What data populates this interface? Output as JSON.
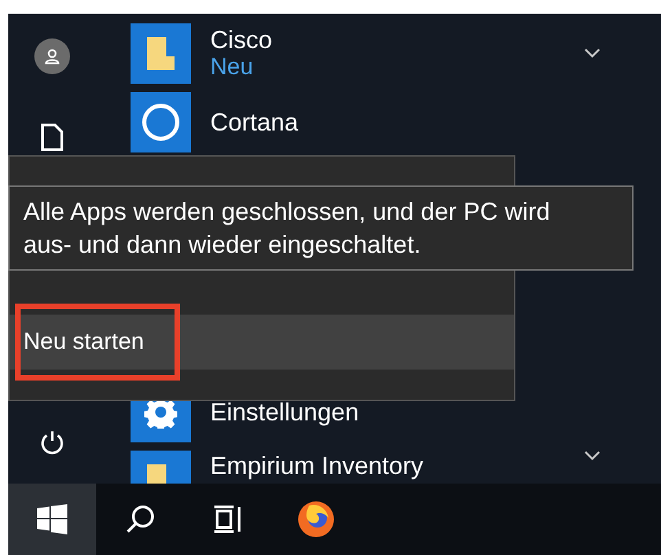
{
  "apps": [
    {
      "name": "Cisco",
      "badge": "Neu",
      "kind": "folder",
      "expandable": true
    },
    {
      "name": "Cortana",
      "kind": "cortana",
      "expandable": false
    },
    {
      "name": "Einstellungen",
      "kind": "settings",
      "expandable": false
    },
    {
      "name": "Empirium Inventory",
      "kind": "folder",
      "expandable": true
    }
  ],
  "power_menu": {
    "items": [
      {
        "label": "Neu starten",
        "selected": true
      }
    ]
  },
  "tooltip": {
    "text": "Alle Apps werden geschlossen, und der PC wird aus- und dann wieder eingeschaltet."
  },
  "taskbar": {
    "items": [
      {
        "kind": "start",
        "selected": true
      },
      {
        "kind": "search",
        "selected": false
      },
      {
        "kind": "task-view",
        "selected": false
      },
      {
        "kind": "firefox",
        "selected": false
      }
    ]
  }
}
